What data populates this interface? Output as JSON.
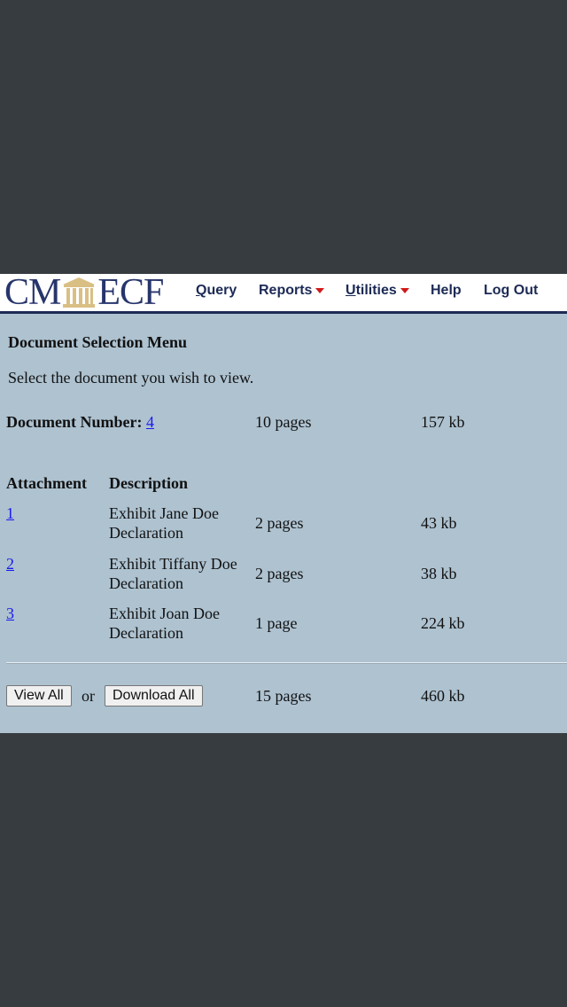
{
  "header": {
    "logo": {
      "left": "CM",
      "right": "ECF",
      "emblem": "courthouse-icon"
    },
    "nav": [
      {
        "label": "Query",
        "underline": "Q",
        "rest": "uery",
        "dropdown": false
      },
      {
        "label": "Reports",
        "dropdown": true
      },
      {
        "label": "Utilities",
        "underline": "U",
        "rest": "tilities",
        "dropdown": true
      },
      {
        "label": "Help",
        "dropdown": false
      },
      {
        "label": "Log Out",
        "dropdown": false
      }
    ]
  },
  "main": {
    "title": "Document Selection Menu",
    "instruction": "Select the document you wish to view.",
    "document": {
      "label": "Document Number:",
      "number": "4",
      "pages": "10 pages",
      "size": "157 kb"
    },
    "columns": {
      "attachment": "Attachment",
      "description": "Description"
    },
    "attachments": [
      {
        "number": "1",
        "description": "Exhibit Jane Doe Declaration",
        "pages": "2 pages",
        "size": "43 kb"
      },
      {
        "number": "2",
        "description": "Exhibit Tiffany Doe Declaration",
        "pages": "2 pages",
        "size": "38 kb"
      },
      {
        "number": "3",
        "description": "Exhibit Joan Doe Declaration",
        "pages": "1 page",
        "size": "224 kb"
      }
    ],
    "footer": {
      "view_all": "View All",
      "or": "or",
      "download_all": "Download All",
      "pages": "15 pages",
      "size": "460 kb"
    }
  },
  "colors": {
    "background": "#373c41",
    "content_bg": "#aec2d0",
    "brand": "#27356c",
    "link": "#1a1aee",
    "caret": "#d01a1a"
  }
}
